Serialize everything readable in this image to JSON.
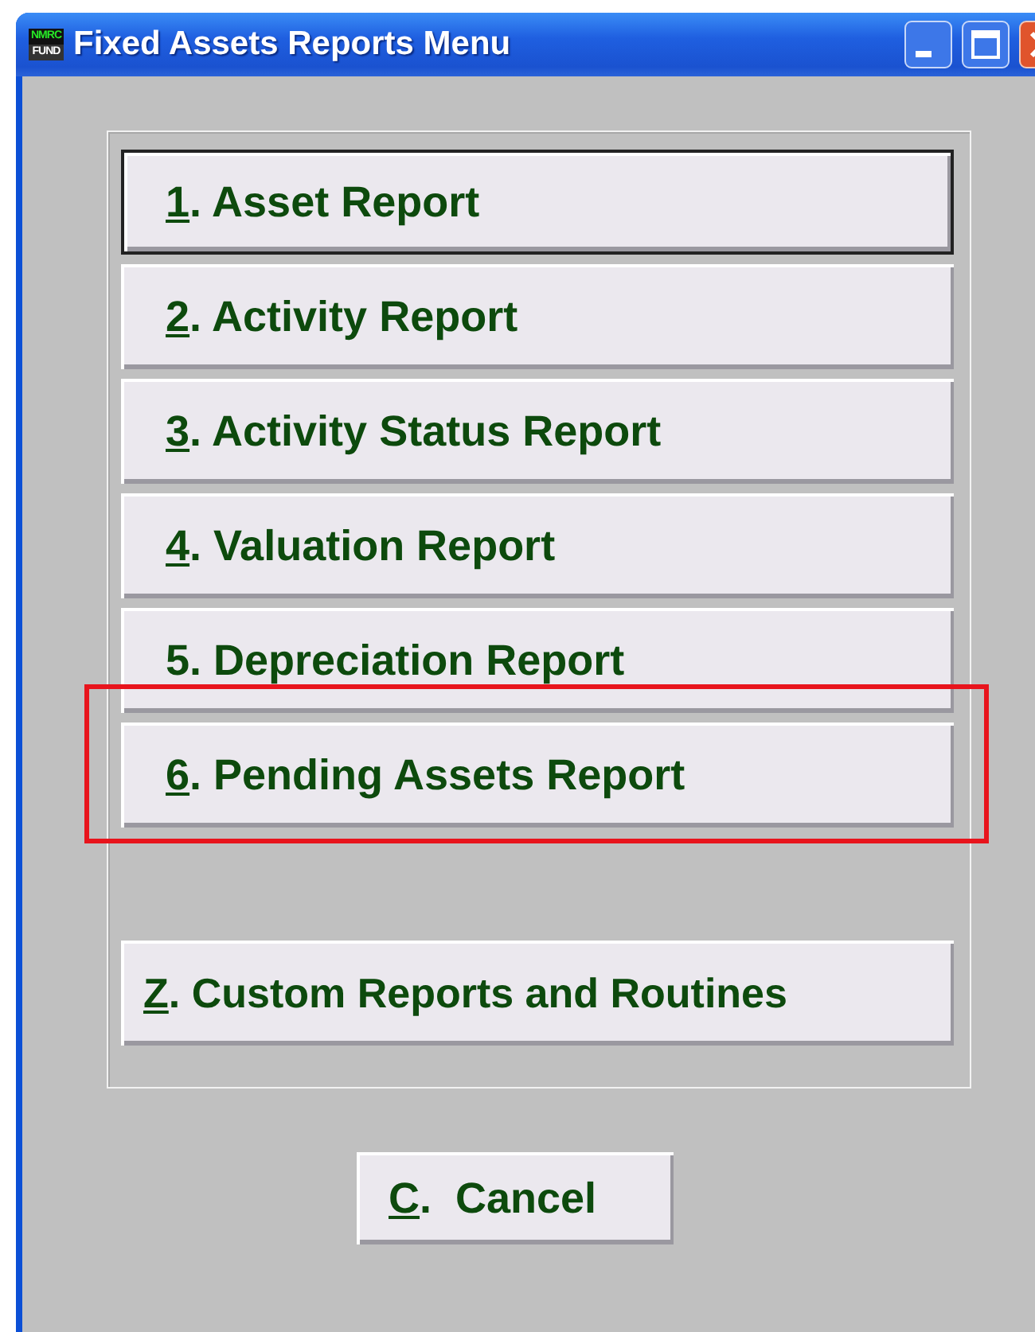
{
  "window": {
    "title": "Fixed Assets Reports Menu",
    "logo": {
      "top": "NMRC",
      "bottom": "FUND"
    }
  },
  "menu_items": [
    {
      "key": "1",
      "rest": ". Asset Report",
      "underlined": true,
      "focused": true,
      "highlighted": false
    },
    {
      "key": "2",
      "rest": ". Activity Report",
      "underlined": true,
      "focused": false,
      "highlighted": false
    },
    {
      "key": "3",
      "rest": ". Activity Status Report",
      "underlined": true,
      "focused": false,
      "highlighted": false
    },
    {
      "key": "4",
      "rest": ". Valuation Report",
      "underlined": true,
      "focused": false,
      "highlighted": false
    },
    {
      "key": "5",
      "rest": ". Depreciation Report",
      "underlined": false,
      "focused": false,
      "highlighted": false
    },
    {
      "key": "6",
      "rest": ". Pending Assets Report",
      "underlined": true,
      "focused": false,
      "highlighted": true
    }
  ],
  "custom_item": {
    "key": "Z",
    "rest": ". Custom Reports and Routines",
    "underlined": true
  },
  "cancel_button": {
    "key": "C",
    "rest": ".  Cancel",
    "underlined": true
  }
}
